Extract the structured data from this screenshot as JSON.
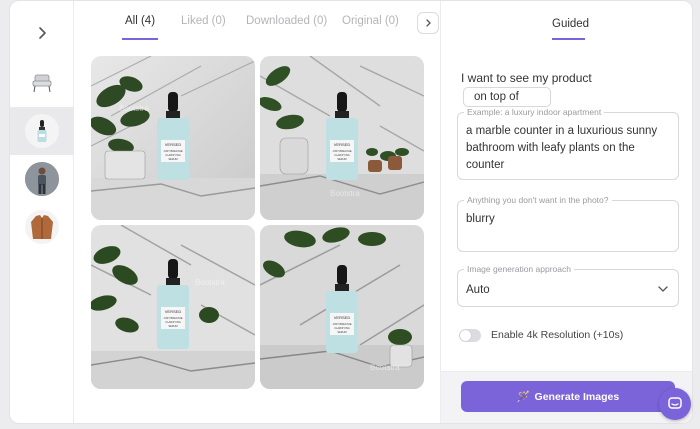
{
  "rail": {
    "thumbs": [
      {
        "name": "armchair-thumbnail",
        "icon": "armchair"
      },
      {
        "name": "serum-bottle-thumbnail",
        "icon": "dropper-bottle"
      },
      {
        "name": "man-outfit-thumbnail",
        "icon": "person"
      },
      {
        "name": "jacket-thumbnail",
        "icon": "jacket"
      }
    ],
    "active_index": 1
  },
  "tabs": [
    {
      "label": "All (4)",
      "active": true
    },
    {
      "label": "Liked (0)",
      "active": false
    },
    {
      "label": "Downloaded (0)",
      "active": false
    },
    {
      "label": "Original (0)",
      "active": false
    }
  ],
  "gallery": {
    "images": [
      {
        "bottle_brand": "VERSED",
        "bottle_line1": "JUST BREATHE",
        "bottle_line2": "CLARIFYING",
        "bottle_line3": "SERUM",
        "watermark": "Bootstra"
      },
      {
        "bottle_brand": "VERSED",
        "bottle_line1": "JUST BREATHE",
        "bottle_line2": "CLARIFYING",
        "bottle_line3": "SERUM",
        "watermark": "Bootstra"
      },
      {
        "bottle_brand": "VERSED",
        "bottle_line1": "JUST BREATHE",
        "bottle_line2": "CLARIFYING",
        "bottle_line3": "SERUM",
        "watermark": "Bootstra"
      },
      {
        "bottle_brand": "VERSED",
        "bottle_line1": "JUST BREATHE",
        "bottle_line2": "CLARIFYING",
        "bottle_line3": "SERUM",
        "watermark": "Bootstra"
      }
    ]
  },
  "form": {
    "mode_tab": "Guided",
    "lead_text": "I want to see my product",
    "position_value": "on top of",
    "scene_label": "Example: a luxury indoor apartment",
    "scene_value": "a marble counter in a luxurious sunny bathroom with leafy plants on the counter",
    "negative_label": "Anything you don't want in the photo?",
    "negative_value": "blurry",
    "approach_label": "Image generation approach",
    "approach_value": "Auto",
    "toggle_label": "Enable 4k Resolution (+10s)",
    "toggle_on": false,
    "generate_label": "Generate Images"
  },
  "colors": {
    "accent": "#7b63d9",
    "tab_inactive": "#b4b4ba"
  }
}
